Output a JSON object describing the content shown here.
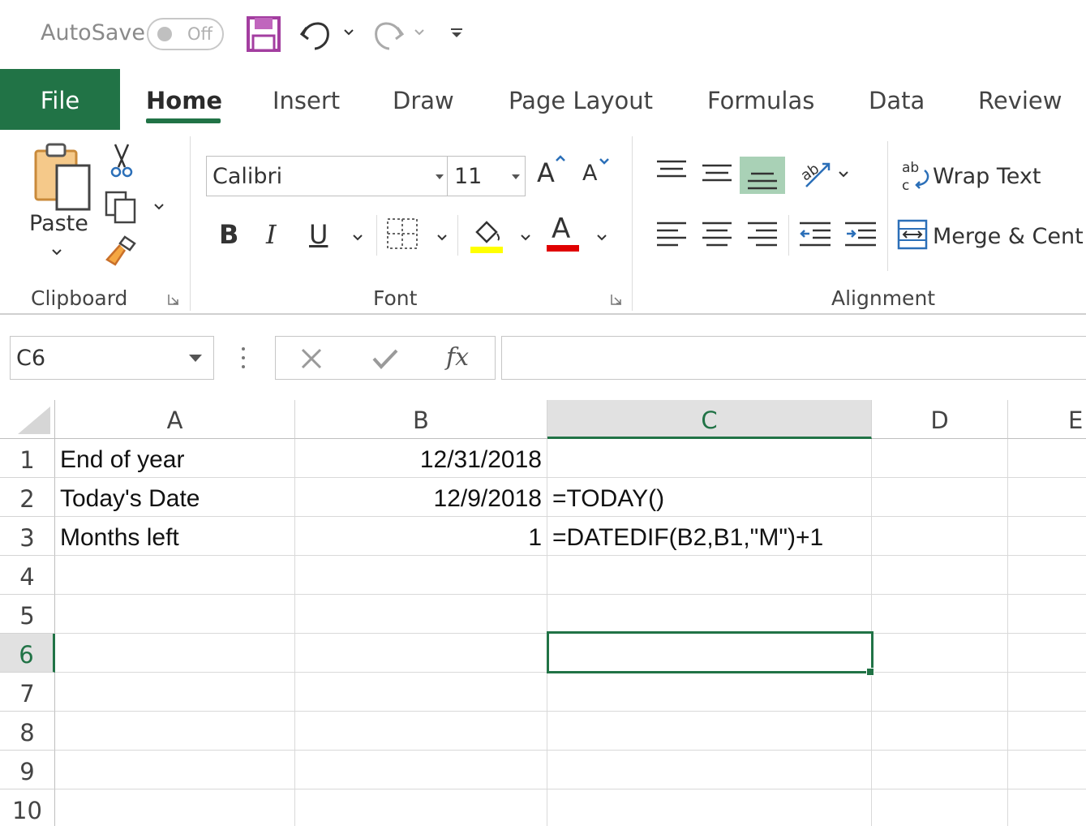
{
  "qat": {
    "autosave_label": "AutoSave",
    "autosave_state": "Off",
    "icons": [
      "save-icon",
      "undo-icon",
      "redo-icon",
      "customize-qat-icon"
    ]
  },
  "tabs": [
    {
      "label": "File"
    },
    {
      "label": "Home"
    },
    {
      "label": "Insert"
    },
    {
      "label": "Draw"
    },
    {
      "label": "Page Layout"
    },
    {
      "label": "Formulas"
    },
    {
      "label": "Data"
    },
    {
      "label": "Review"
    }
  ],
  "ribbon": {
    "clipboard": {
      "label": "Clipboard",
      "paste_label": "Paste"
    },
    "font": {
      "label": "Font",
      "font_name": "Calibri",
      "font_size": "11",
      "bold": "B",
      "italic": "I",
      "underline": "U",
      "grow_font": "A",
      "shrink_font": "A",
      "font_color_letter": "A"
    },
    "alignment": {
      "label": "Alignment",
      "wrap_text": "Wrap Text",
      "merge_center": "Merge & Cent"
    }
  },
  "formula_bar": {
    "name_box": "C6",
    "fx_label": "fx",
    "formula": ""
  },
  "colors": {
    "accent": "#217346",
    "fill_color": "#ffff00",
    "font_color": "#e00000",
    "selected_header_bg": "#e1e1e1"
  },
  "sheet": {
    "columns": [
      "A",
      "B",
      "C",
      "D",
      "E"
    ],
    "rows": [
      "1",
      "2",
      "3",
      "4",
      "5",
      "6",
      "7",
      "8",
      "9",
      "10"
    ],
    "selected_cell": "C6",
    "cells": {
      "A1": "End of year",
      "B1": "12/31/2018",
      "A2": "Today's Date",
      "B2": "12/9/2018",
      "C2": "=TODAY()",
      "A3": "Months left",
      "B3": "1",
      "C3": "=DATEDIF(B2,B1,\"M\")+1"
    }
  }
}
